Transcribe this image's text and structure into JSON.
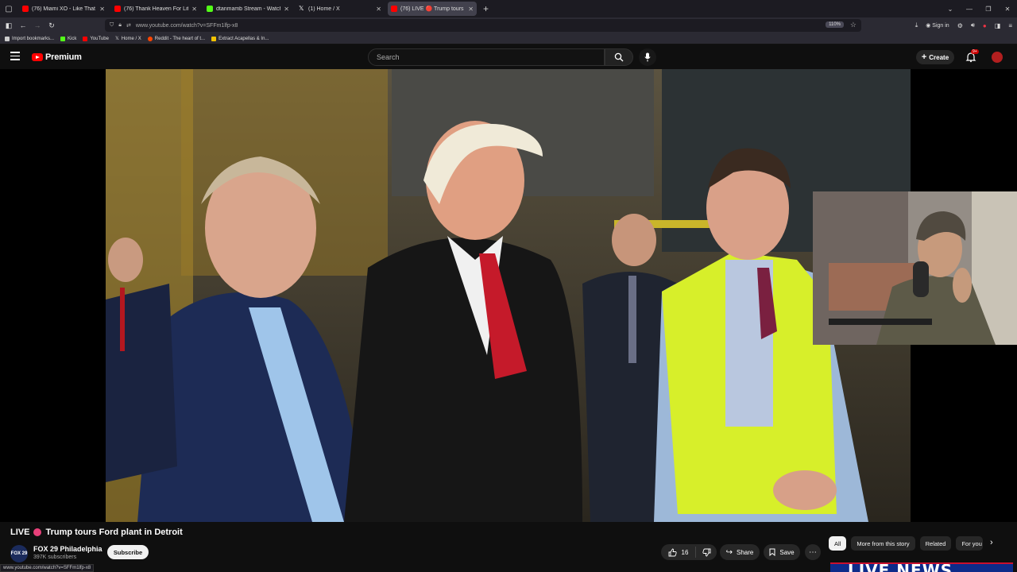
{
  "browser": {
    "tabs": [
      {
        "label": "(76) Miami XO - Like That (Offi",
        "favicon_color": "#ff0000"
      },
      {
        "label": "(76) Thank Heaven For Little Gi",
        "favicon_color": "#ff0000"
      },
      {
        "label": "dtanmamb Stream - Watch Live",
        "favicon_color": "#53fc18"
      },
      {
        "label": "(1) Home / X",
        "favicon_color": "#ffffff"
      },
      {
        "label": "(76) LIVE 🔴 Trump tours F",
        "favicon_color": "#ff0000",
        "active": true
      }
    ],
    "url": "www.youtube.com/watch?v=SFFm1lfp-x8",
    "zoom": "110%",
    "signin_label": "Sign in",
    "bookmarks": [
      {
        "label": "Import bookmarks...",
        "color": "#cccccc"
      },
      {
        "label": "Kick",
        "color": "#53fc18"
      },
      {
        "label": "YouTube",
        "color": "#ff0000"
      },
      {
        "label": "Home / X",
        "color": "#ffffff"
      },
      {
        "label": "Reddit - The heart of t...",
        "color": "#ff4500"
      },
      {
        "label": "Extract Acapellas & In...",
        "color": "#f2c200"
      }
    ],
    "status_url": "www.youtube.com/watch?v=SFFm1lfp-x8"
  },
  "youtube": {
    "logo_text": "Premium",
    "search_placeholder": "Search",
    "create_label": "Create",
    "notifications_badge": "9+"
  },
  "video": {
    "live_label": "LIVE",
    "title": "Trump tours Ford plant in Detroit",
    "channel_name": "FOX 29 Philadelphia",
    "channel_avatar_text": "FOX 29",
    "subscribers": "397K subscribers",
    "subscribe_label": "Subscribe",
    "likes": "16",
    "share_label": "Share",
    "save_label": "Save",
    "overlay_banner": "LIVE NEWS"
  },
  "chips": [
    "All",
    "More from this story",
    "Related",
    "For you"
  ]
}
